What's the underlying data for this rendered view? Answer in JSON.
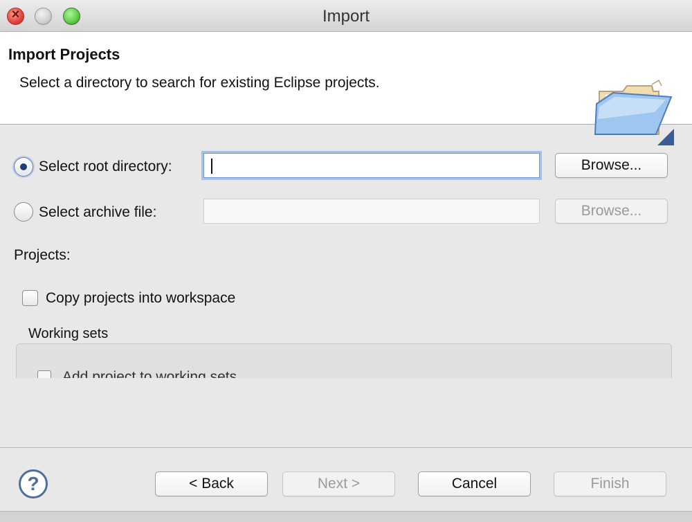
{
  "window": {
    "title": "Import"
  },
  "banner": {
    "title": "Import Projects",
    "description": "Select a directory to search for existing Eclipse projects.",
    "icon": "folder-icon"
  },
  "source": {
    "root_directory": {
      "label": "Select root directory:",
      "selected": true,
      "value": "",
      "browse_label": "Browse..."
    },
    "archive_file": {
      "label": "Select archive file:",
      "selected": false,
      "value": "",
      "browse_label": "Browse..."
    }
  },
  "projects": {
    "label": "Projects:",
    "copy_checkbox_label": "Copy projects into workspace",
    "copy_checked": false
  },
  "working_sets": {
    "label": "Working sets",
    "add_checkbox_label": "Add project to working sets"
  },
  "footer": {
    "help_icon": "help-icon",
    "back_label": "< Back",
    "next_label": "Next >",
    "cancel_label": "Cancel",
    "finish_label": "Finish"
  },
  "colors": {
    "focus_ring": "#6f9ad6",
    "dialog_bg": "#e8e8e8",
    "banner_bg": "#ffffff",
    "disabled_text": "#9a9a9a"
  }
}
